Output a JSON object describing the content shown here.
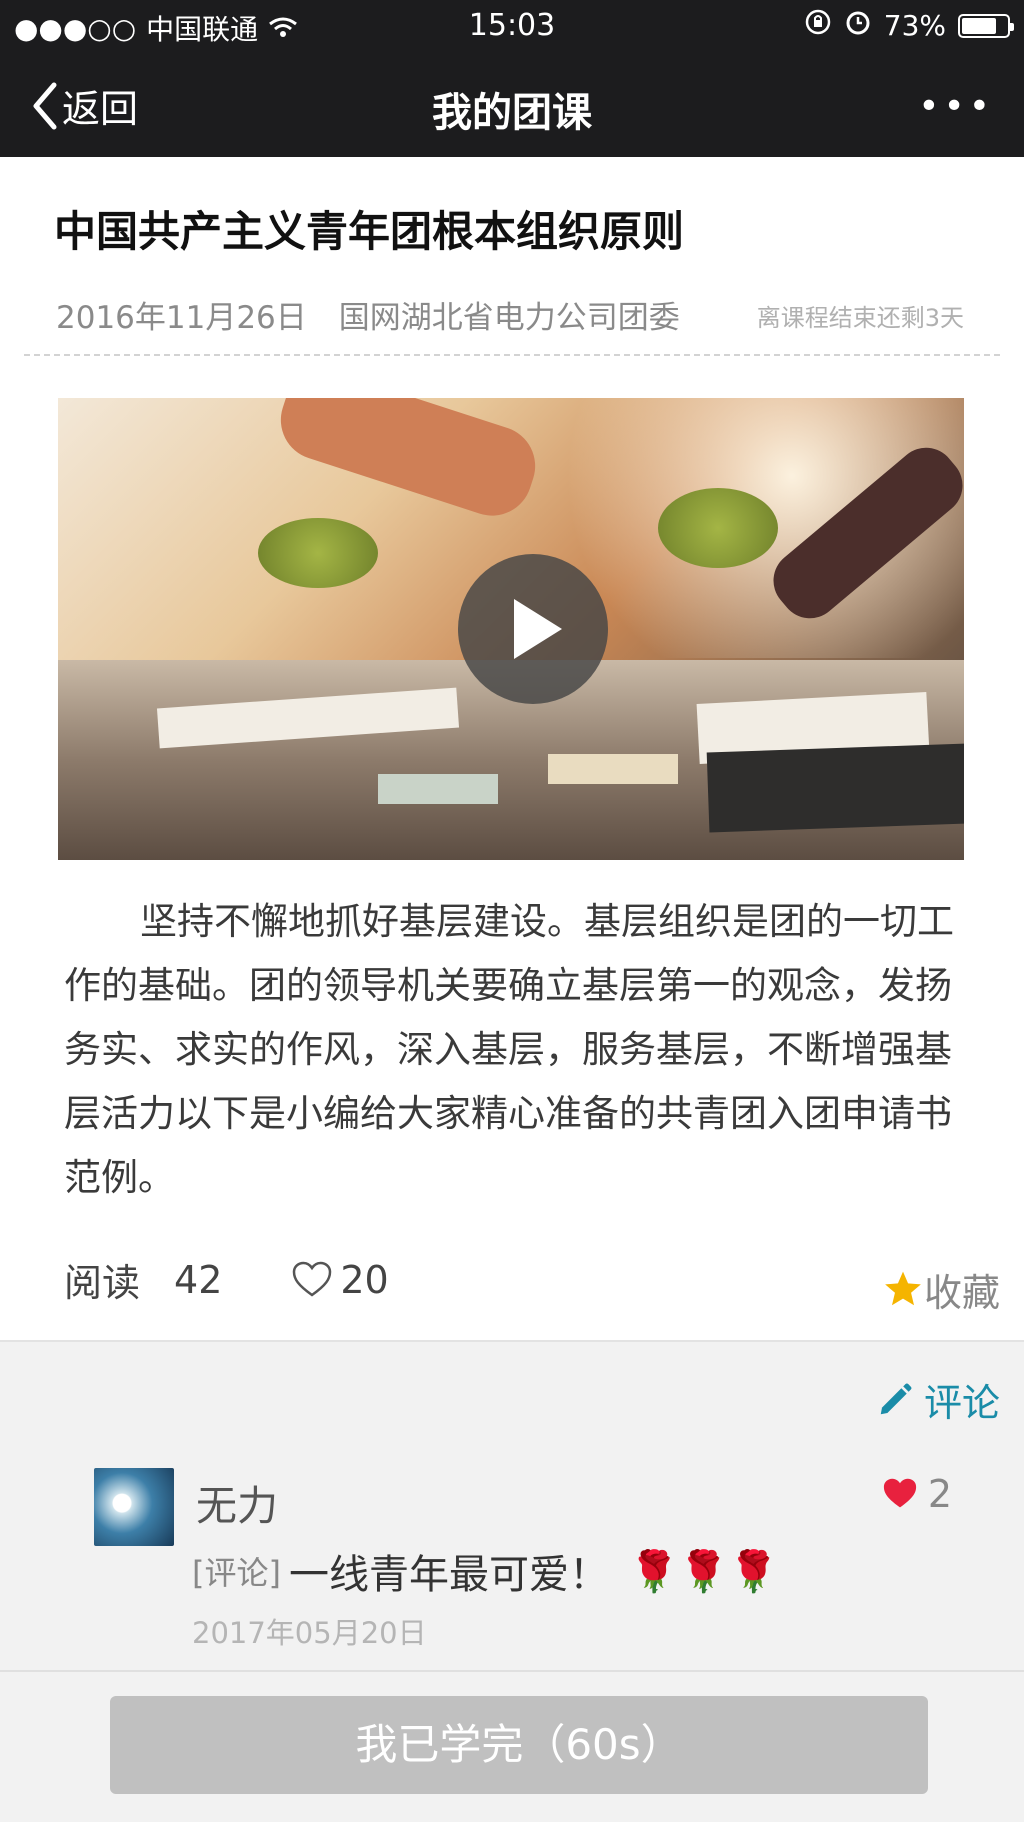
{
  "status_bar": {
    "signal": "●●●○○",
    "carrier": "中国联通",
    "time": "15:03",
    "battery": "73%"
  },
  "nav": {
    "back_label": "返回",
    "title": "我的团课",
    "more_label": "•••"
  },
  "article": {
    "title": "中国共产主义青年团根本组织原则",
    "date": "2016年11月26日",
    "org": "国网湖北省电力公司团委",
    "remaining": "离课程结束还剩3天",
    "body": "坚持不懈地抓好基层建设。基层组织是团的一切工作的基础。团的领导机关要确立基层第一的观念，发扬务实、求实的作风，深入基层，服务基层，不断增强基层活力以下是小编给大家精心准备的共青团入团申请书范例。"
  },
  "stats": {
    "read_label": "阅读",
    "read_count": "42",
    "like_count": "20",
    "favorite_label": "收藏"
  },
  "comments": {
    "action_label": "评论",
    "items": [
      {
        "name": "无力",
        "likes": "2",
        "tag": "[评论]",
        "text": "一线青年最可爱！",
        "roses": "🌹🌹🌹",
        "date": "2017年05月20日"
      }
    ]
  },
  "bottom": {
    "done_label": "我已学完（60s）"
  },
  "colors": {
    "nav_bg": "#1c1c1e",
    "accent": "#1a8ca8",
    "heart": "#e8213e",
    "star": "#f5b400",
    "button_disabled": "#c0c0c0"
  }
}
